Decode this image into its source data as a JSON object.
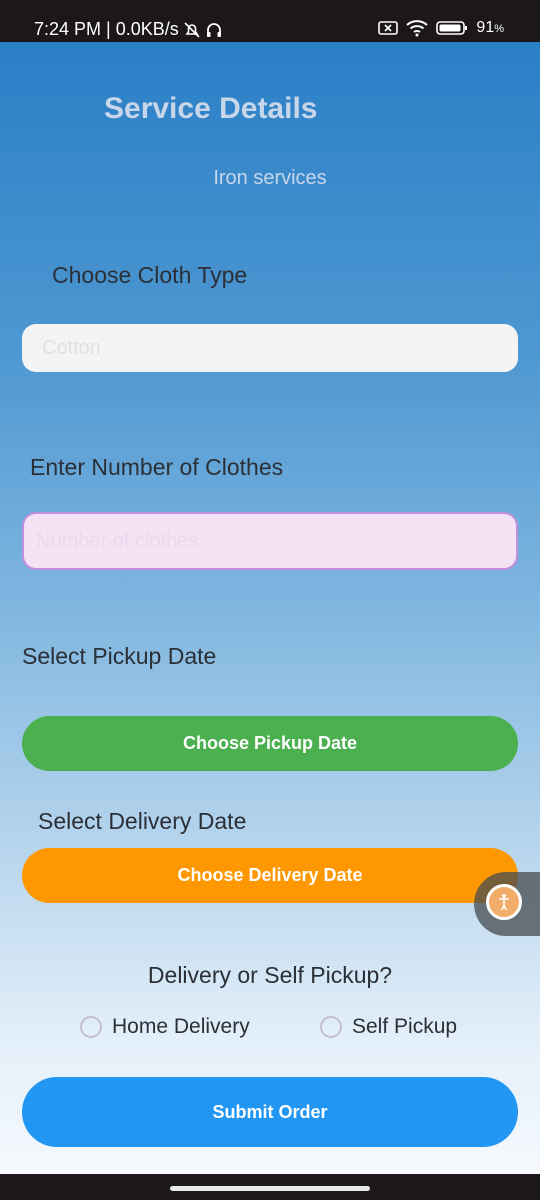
{
  "status_bar": {
    "time_speed": "7:24 PM | 0.0KB/s",
    "battery": "91"
  },
  "page": {
    "title": "Service Details",
    "subtitle": "Iron services"
  },
  "cloth": {
    "label": "Choose Cloth Type",
    "placeholder": "Cotton"
  },
  "count": {
    "label": "Enter Number of Clothes",
    "placeholder": "Number of clothes"
  },
  "pickup": {
    "label": "Select Pickup Date",
    "button": "Choose Pickup Date"
  },
  "delivery": {
    "label": "Select Delivery Date",
    "button": "Choose Delivery Date"
  },
  "mode": {
    "question": "Delivery or Self Pickup?",
    "options": [
      "Home Delivery",
      "Self Pickup"
    ]
  },
  "submit": {
    "label": "Submit Order"
  },
  "colors": {
    "pickup_button": "#4caf50",
    "delivery_button": "#ff9800",
    "submit_button": "#2196f3"
  }
}
